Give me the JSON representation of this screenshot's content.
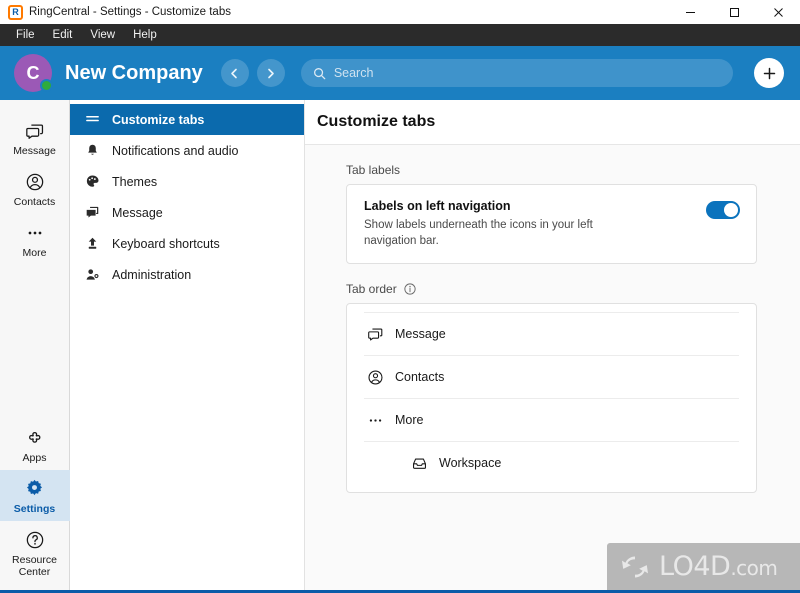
{
  "titlebar": {
    "logo_letter": "R",
    "title": "RingCentral - Settings - Customize tabs",
    "minimize_label": "Minimize",
    "maximize_label": "Maximize",
    "close_label": "Close"
  },
  "menubar": {
    "items": [
      {
        "label": "File"
      },
      {
        "label": "Edit"
      },
      {
        "label": "View"
      },
      {
        "label": "Help"
      }
    ]
  },
  "appheader": {
    "avatar_letter": "C",
    "presence_color": "#2eab3d",
    "company_name": "New Company",
    "back_label": "Back",
    "forward_label": "Forward",
    "search_placeholder": "Search",
    "add_label": "+",
    "accent_color": "#1b7fc1"
  },
  "rail": {
    "items": [
      {
        "label": "Message",
        "icon": "message-icon",
        "active": false
      },
      {
        "label": "Contacts",
        "icon": "contacts-icon",
        "active": false
      },
      {
        "label": "More",
        "icon": "more-icon",
        "active": false
      }
    ],
    "bottom_items": [
      {
        "label": "Apps",
        "icon": "apps-icon",
        "active": false
      },
      {
        "label": "Settings",
        "icon": "gear-icon",
        "active": true
      },
      {
        "label": "Resource Center",
        "icon": "help-icon",
        "active": false
      }
    ],
    "active_color": "#0b5ca8"
  },
  "settings_list": {
    "items": [
      {
        "label": "Customize tabs",
        "icon": "hamburger-icon",
        "active": true
      },
      {
        "label": "Notifications and audio",
        "icon": "bell-icon",
        "active": false
      },
      {
        "label": "Themes",
        "icon": "palette-icon",
        "active": false
      },
      {
        "label": "Message",
        "icon": "message-icon",
        "active": false
      },
      {
        "label": "Keyboard shortcuts",
        "icon": "keyboard-icon",
        "active": false
      },
      {
        "label": "Administration",
        "icon": "admin-user-icon",
        "active": false
      }
    ],
    "active_color": "#0b6aad"
  },
  "main": {
    "title": "Customize tabs",
    "tab_labels": {
      "section_label": "Tab labels",
      "setting_title": "Labels on left navigation",
      "setting_desc": "Show labels underneath the icons in your left navigation bar.",
      "toggle_on": true,
      "toggle_color": "#0b73bd"
    },
    "tab_order": {
      "section_label": "Tab order",
      "info_tooltip": "info-icon",
      "rows": [
        {
          "label": "Message",
          "icon": "message-icon",
          "indent": false
        },
        {
          "label": "Contacts",
          "icon": "contacts-icon",
          "indent": false
        },
        {
          "label": "More",
          "icon": "more-icon",
          "indent": false
        },
        {
          "label": "Workspace",
          "icon": "workspace-icon",
          "indent": true
        }
      ]
    }
  },
  "watermark": {
    "text": "LO4D",
    "suffix": ".com"
  }
}
